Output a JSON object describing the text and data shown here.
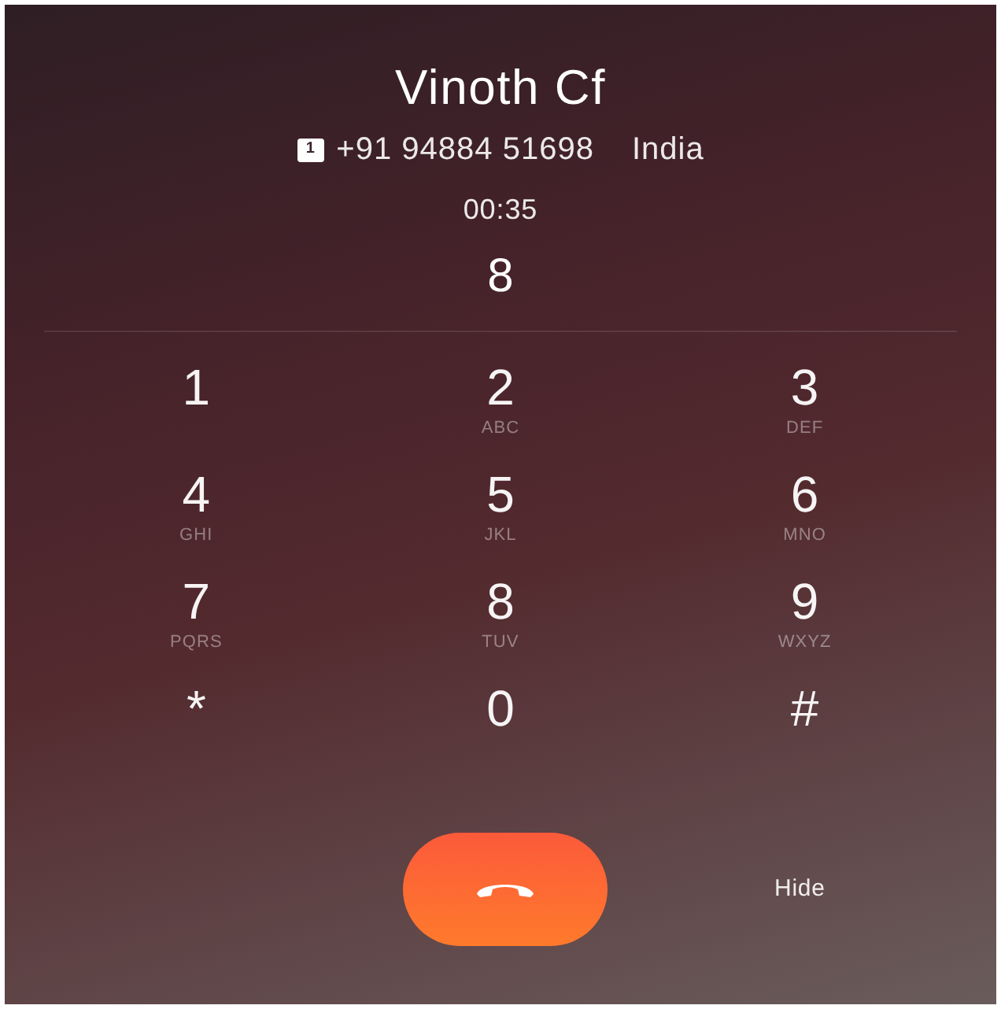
{
  "contact": {
    "name": "Vinoth Cf",
    "sim": "1",
    "number": "+91 94884 51698",
    "country": "India",
    "duration": "00:35"
  },
  "dialed": "8",
  "keypad": [
    {
      "digit": "1"
    },
    {
      "digit": "2",
      "letters": "ABC"
    },
    {
      "digit": "3",
      "letters": "DEF"
    },
    {
      "digit": "4",
      "letters": "GHI"
    },
    {
      "digit": "5",
      "letters": "JKL"
    },
    {
      "digit": "6",
      "letters": "MNO"
    },
    {
      "digit": "7",
      "letters": "PQRS"
    },
    {
      "digit": "8",
      "letters": "TUV"
    },
    {
      "digit": "9",
      "letters": "WXYZ"
    },
    {
      "digit": "*"
    },
    {
      "digit": "0"
    },
    {
      "digit": "#"
    }
  ],
  "hide_button": "Hide"
}
